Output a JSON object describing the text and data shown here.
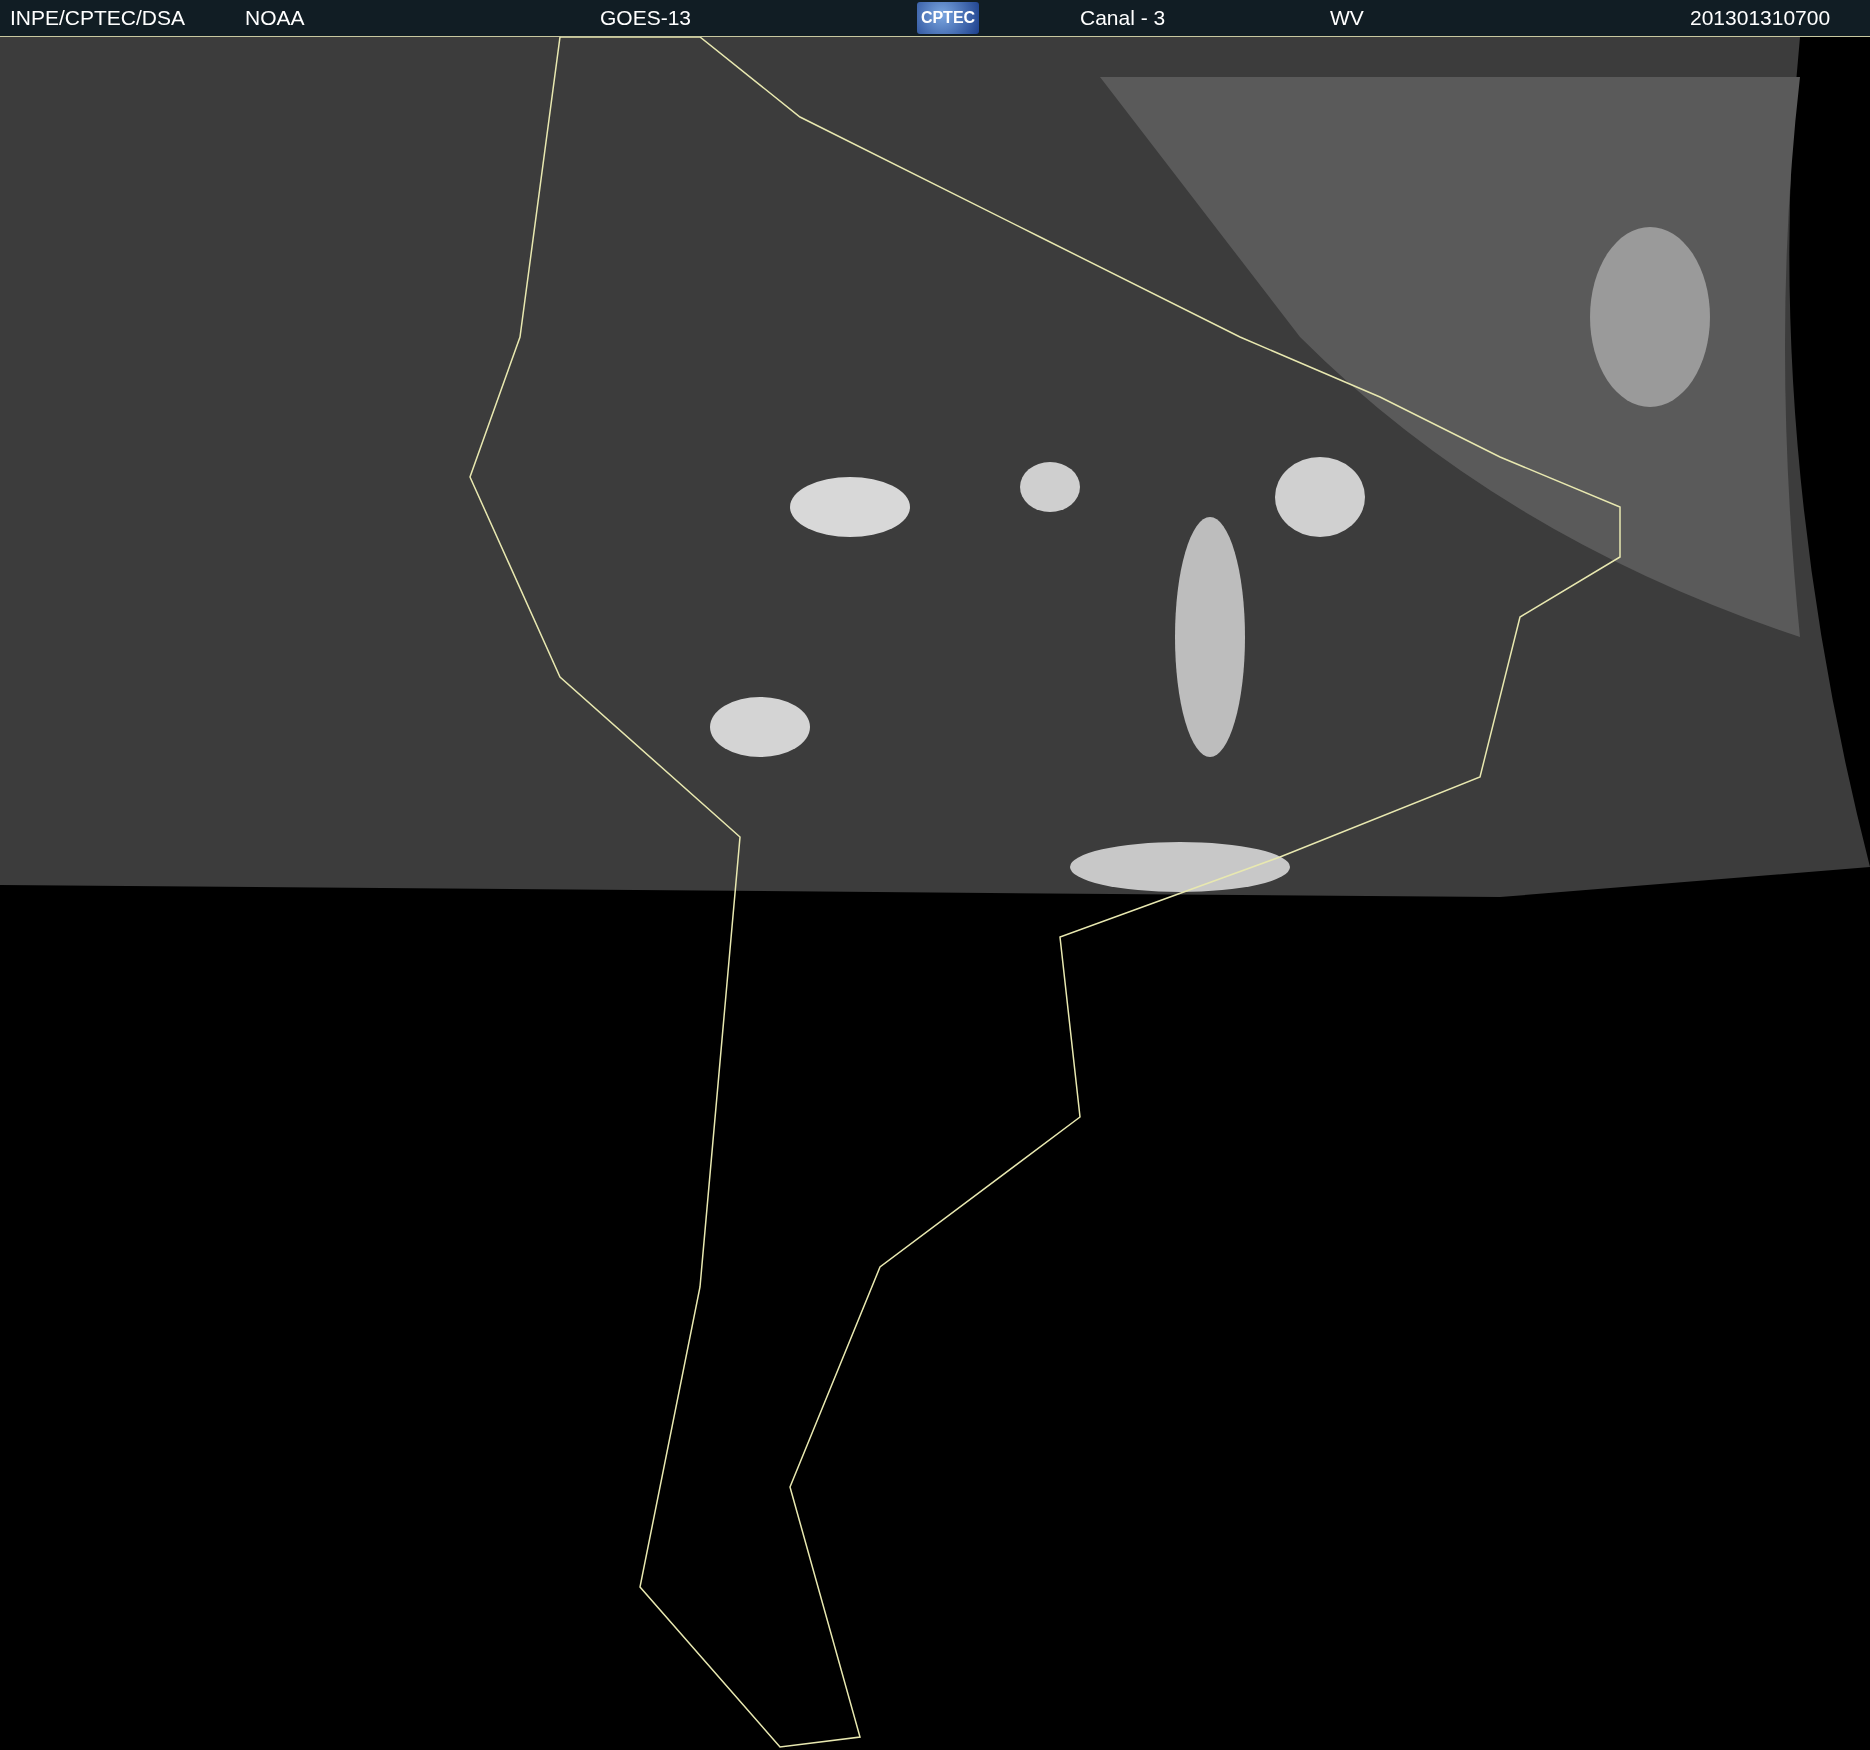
{
  "header": {
    "items": [
      {
        "text": "INPE/CPTEC/DSA"
      },
      {
        "text": "NOAA"
      },
      {
        "text": "GOES-13"
      },
      {
        "text": "CPTEC",
        "kind": "logo"
      },
      {
        "text": "Canal - 3"
      },
      {
        "text": "WV"
      },
      {
        "text": "201301310700"
      }
    ]
  }
}
